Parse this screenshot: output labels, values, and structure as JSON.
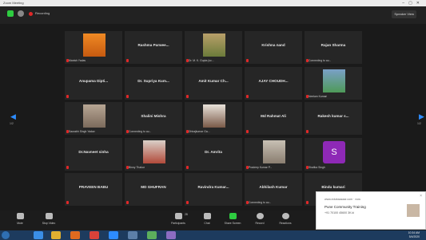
{
  "window": {
    "title": "Zoom Meeting"
  },
  "topbar": {
    "recording": "Recording",
    "view_button": "Speaker View"
  },
  "participants": [
    {
      "name": "",
      "label": "Manish Yadav",
      "photo": "sunset",
      "muted": true
    },
    {
      "name": "Rashma Parwee...",
      "label": "",
      "muted": true
    },
    {
      "name": "",
      "label": "Dr. M. K. Gupta (sc...",
      "photo": "man-with-shirt",
      "muted": true
    },
    {
      "name": "Krishna nand",
      "label": "",
      "muted": true
    },
    {
      "name": "Rajan Sharma",
      "label": "Connecting to au...",
      "muted": true
    },
    {
      "name": "Anupama Dipti...",
      "label": "",
      "muted": true
    },
    {
      "name": "Dr. Supriya Kum...",
      "label": "",
      "muted": true
    },
    {
      "name": "Amit Kumar Ch...",
      "label": "",
      "muted": true
    },
    {
      "name": "AJAY CHOUDH...",
      "label": "",
      "muted": true
    },
    {
      "name": "",
      "label": "Neelam Kumari",
      "photo": "flowers",
      "muted": true
    },
    {
      "name": "",
      "label": "Saurabh Singh Yadav",
      "photo": "woman",
      "muted": true
    },
    {
      "name": "Shalini Mishra",
      "label": "Connecting to au...",
      "muted": true
    },
    {
      "name": "",
      "label": "Dhirajkumar Ga...",
      "photo": "man-portrait",
      "muted": true
    },
    {
      "name": "Md Rahmat Ali",
      "label": "",
      "muted": true
    },
    {
      "name": "Rakesh kumar s...",
      "label": "",
      "muted": true
    },
    {
      "name": "Dr.Navneet sinha",
      "label": "",
      "muted": true
    },
    {
      "name": "",
      "label": "Binny Thakur",
      "photo": "person",
      "muted": true
    },
    {
      "name": "Dr. Amrita",
      "label": "",
      "muted": true
    },
    {
      "name": "",
      "label": "Pradeep Kumar P...",
      "photo": "man-white",
      "muted": true
    },
    {
      "name": "",
      "label": "Shalika Singh",
      "letter": "S",
      "muted": true
    },
    {
      "name": "PRAVEEN BABU",
      "label": "",
      "muted": true
    },
    {
      "name": "MD GHUFRAN",
      "label": "",
      "muted": true
    },
    {
      "name": "Ravindra Kumar...",
      "label": "",
      "muted": true
    },
    {
      "name": "Abhilash Kumar",
      "label": "Connecting to au...",
      "muted": true
    },
    {
      "name": "Bindu kumari",
      "label": "",
      "muted": true
    }
  ],
  "nav": {
    "prev_icon": "◀",
    "next_icon": "▶",
    "prev_page": "1/2",
    "next_page": "1/2"
  },
  "toolbar": {
    "unmute": "Mute",
    "start_video": "Stop Video",
    "participants": "Participants",
    "participants_count": "28",
    "chat": "Chat",
    "share_screen": "Share Screen",
    "record": "Record",
    "reactions": "Reactions",
    "end": "End"
  },
  "toast": {
    "source": "www.edubaazaar.com · now",
    "title": "Pune Community Training",
    "body": "+91 70100 45600 3K.ki",
    "close_icon": "×"
  },
  "clock": {
    "time": "10:34 AM",
    "date": "5/4/2020"
  },
  "colors": {
    "accent": "#2d8cff",
    "mute_red": "#e02828",
    "letter_avatar": "#8e29b6",
    "toolbar_green": "#2ecc40"
  }
}
